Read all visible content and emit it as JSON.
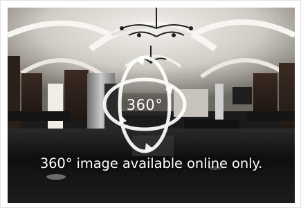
{
  "badge": {
    "label": "360°"
  },
  "caption": {
    "text": "360° image available online only."
  },
  "icons": {
    "badge": "360-degree-icon"
  }
}
